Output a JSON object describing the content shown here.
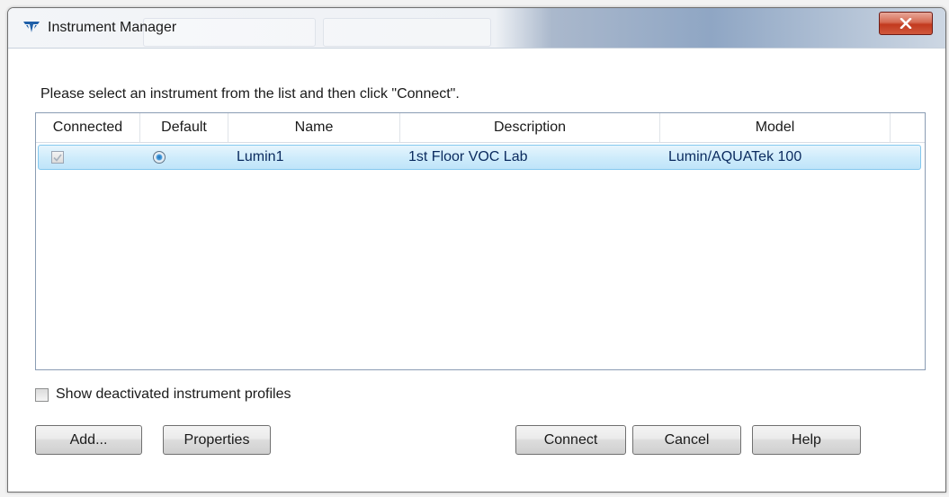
{
  "window": {
    "title": "Instrument Manager",
    "close_glyph": "✕"
  },
  "prompt": "Please select an instrument from the list and then click \"Connect\".",
  "list": {
    "columns": [
      {
        "label": "Connected"
      },
      {
        "label": "Default"
      },
      {
        "label": "Name"
      },
      {
        "label": "Description"
      },
      {
        "label": "Model"
      }
    ],
    "rows": [
      {
        "connected": true,
        "default": true,
        "name": "Lumin1",
        "description": "1st Floor VOC Lab",
        "model": "Lumin/AQUATek 100"
      }
    ]
  },
  "options": {
    "show_deactivated_label": "Show deactivated instrument profiles",
    "show_deactivated_checked": false
  },
  "buttons": {
    "add": "Add...",
    "properties": "Properties",
    "connect": "Connect",
    "cancel": "Cancel",
    "help": "Help"
  },
  "icons": {
    "app": "teledyne-logo-icon",
    "close": "close-icon",
    "connected_check": "checkmark-icon",
    "default_radio": "radio-selected-icon"
  },
  "colors": {
    "selection_border": "#84c8ee",
    "selection_fill": "#cdebfb",
    "close_button": "#c94a2e",
    "app_icon": "#1f5fa8"
  }
}
